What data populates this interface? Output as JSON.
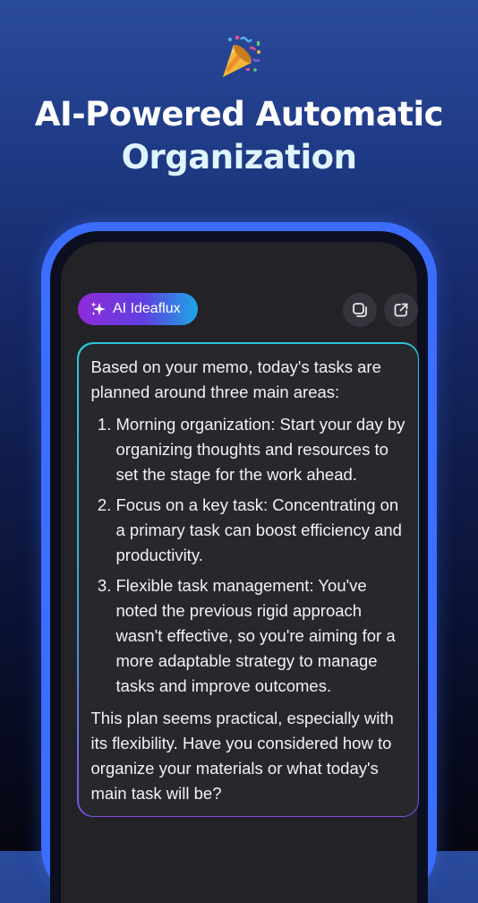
{
  "header": {
    "emoji": "party-popper-icon",
    "title_line1": "AI-Powered Automatic",
    "title_line2": "Organization"
  },
  "assistant": {
    "badge_label": "AI Ideaflux",
    "badge_icon": "sparkles-icon",
    "copy_icon": "copy-icon",
    "share_icon": "external-link-icon"
  },
  "message": {
    "intro": "Based on your memo, today's tasks are planned around three main areas:",
    "items": [
      "Morning organization: Start your day by organizing thoughts and resources to set the stage for the work ahead.",
      "Focus on a key task: Concentrating on a primary task can boost efficiency and productivity.",
      "Flexible task management: You've noted the previous rigid approach wasn't effective, so you're aiming for a more adaptable strategy to manage tasks and improve outcomes."
    ],
    "outro": "This plan seems practical, especially with its flexibility. Have you considered how to organize your materials or what today's main task will be?"
  },
  "colors": {
    "badge_gradient": [
      "#8f2bd9",
      "#1ba7e6"
    ],
    "phone_frame": "#3b6dff",
    "card_border": [
      "#2cc6d8",
      "#7f4fe0"
    ]
  }
}
